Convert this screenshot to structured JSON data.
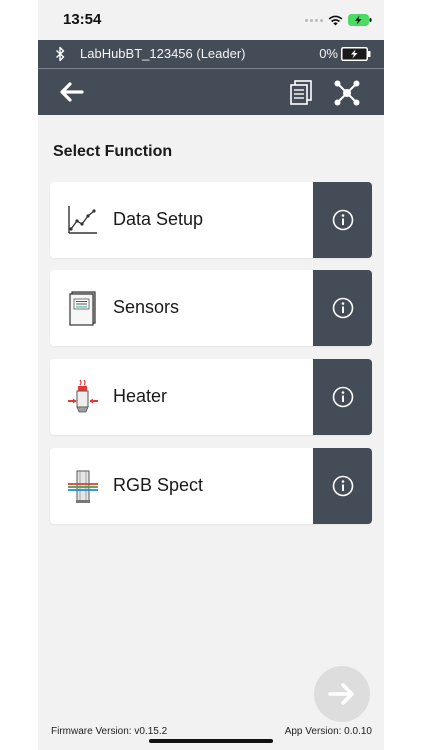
{
  "status_bar": {
    "time": "13:54"
  },
  "device_bar": {
    "device_name": "LabHubBT_123456 (Leader)",
    "battery_percent": "0%"
  },
  "toolbar": {
    "back_icon": "arrow-left-icon",
    "documents_icon": "documents-icon",
    "network_icon": "network-icon"
  },
  "section_title": "Select Function",
  "functions": [
    {
      "label": "Data Setup",
      "icon": "line-chart-icon"
    },
    {
      "label": "Sensors",
      "icon": "sensor-module-icon"
    },
    {
      "label": "Heater",
      "icon": "heater-icon"
    },
    {
      "label": "RGB Spect",
      "icon": "rgb-spectrometer-icon"
    }
  ],
  "footer": {
    "firmware_version": "Firmware Version: v0.15.2",
    "app_version": "App Version: 0.0.10"
  },
  "colors": {
    "bar_background": "#444c58",
    "page_background": "#f2f2f2",
    "card_background": "#ffffff",
    "battery_charging": "#4cd964",
    "heater_red": "#e53935"
  }
}
